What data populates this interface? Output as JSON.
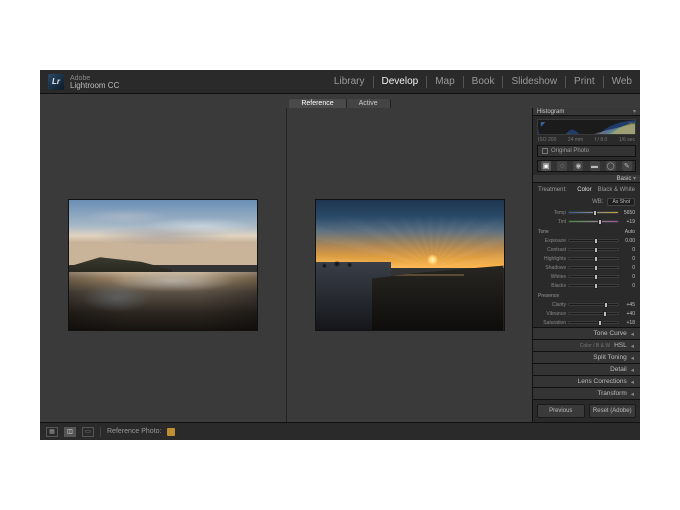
{
  "brand": {
    "line1": "Adobe",
    "line2": "Lightroom CC",
    "logo": "Lr"
  },
  "modules": [
    "Library",
    "Develop",
    "Map",
    "Book",
    "Slideshow",
    "Print",
    "Web"
  ],
  "active_module": "Develop",
  "compare_tabs": {
    "left": "Reference",
    "right": "Active",
    "active": "Reference"
  },
  "histogram": {
    "title": "Histogram",
    "meta": [
      "ISO 200",
      "24 mm",
      "f / 8.0",
      "1/6 sec"
    ],
    "original_label": "Original Photo"
  },
  "tools": [
    "crop",
    "spot",
    "redeye",
    "grad",
    "radial",
    "brush"
  ],
  "basic": {
    "title": "Basic",
    "treat_label": "Treatment:",
    "treat_color": "Color",
    "treat_bw": "Black & White",
    "wb_label": "WB:",
    "wb_value": "As Shot",
    "sliders_wb": [
      {
        "name": "Temp",
        "value": 5650,
        "pos": 48,
        "cls": "temp"
      },
      {
        "name": "Tint",
        "value": "+19",
        "pos": 60,
        "cls": "tint"
      }
    ],
    "tone_label": "Tone",
    "auto_label": "Auto",
    "sliders_tone": [
      {
        "name": "Exposure",
        "value": "0.00",
        "pos": 50
      },
      {
        "name": "Contrast",
        "value": "0",
        "pos": 50
      },
      {
        "name": "Highlights",
        "value": "0",
        "pos": 50
      },
      {
        "name": "Shadows",
        "value": "0",
        "pos": 50
      },
      {
        "name": "Whites",
        "value": "0",
        "pos": 50
      },
      {
        "name": "Blacks",
        "value": "0",
        "pos": 50
      }
    ],
    "presence_label": "Presence",
    "sliders_presence": [
      {
        "name": "Clarity",
        "value": "+45",
        "pos": 72
      },
      {
        "name": "Vibrance",
        "value": "+40",
        "pos": 70
      },
      {
        "name": "Saturation",
        "value": "+18",
        "pos": 59
      }
    ]
  },
  "collapsed_panels": [
    {
      "label": "Tone Curve"
    },
    {
      "label": "HSL",
      "sub": "Color / B & W"
    },
    {
      "label": "Split Toning"
    },
    {
      "label": "Detail"
    },
    {
      "label": "Lens Corrections"
    },
    {
      "label": "Transform"
    }
  ],
  "buttons": {
    "prev": "Previous",
    "reset": "Reset (Adobe)"
  },
  "bottom": {
    "ref_label": "Reference Photo:"
  }
}
